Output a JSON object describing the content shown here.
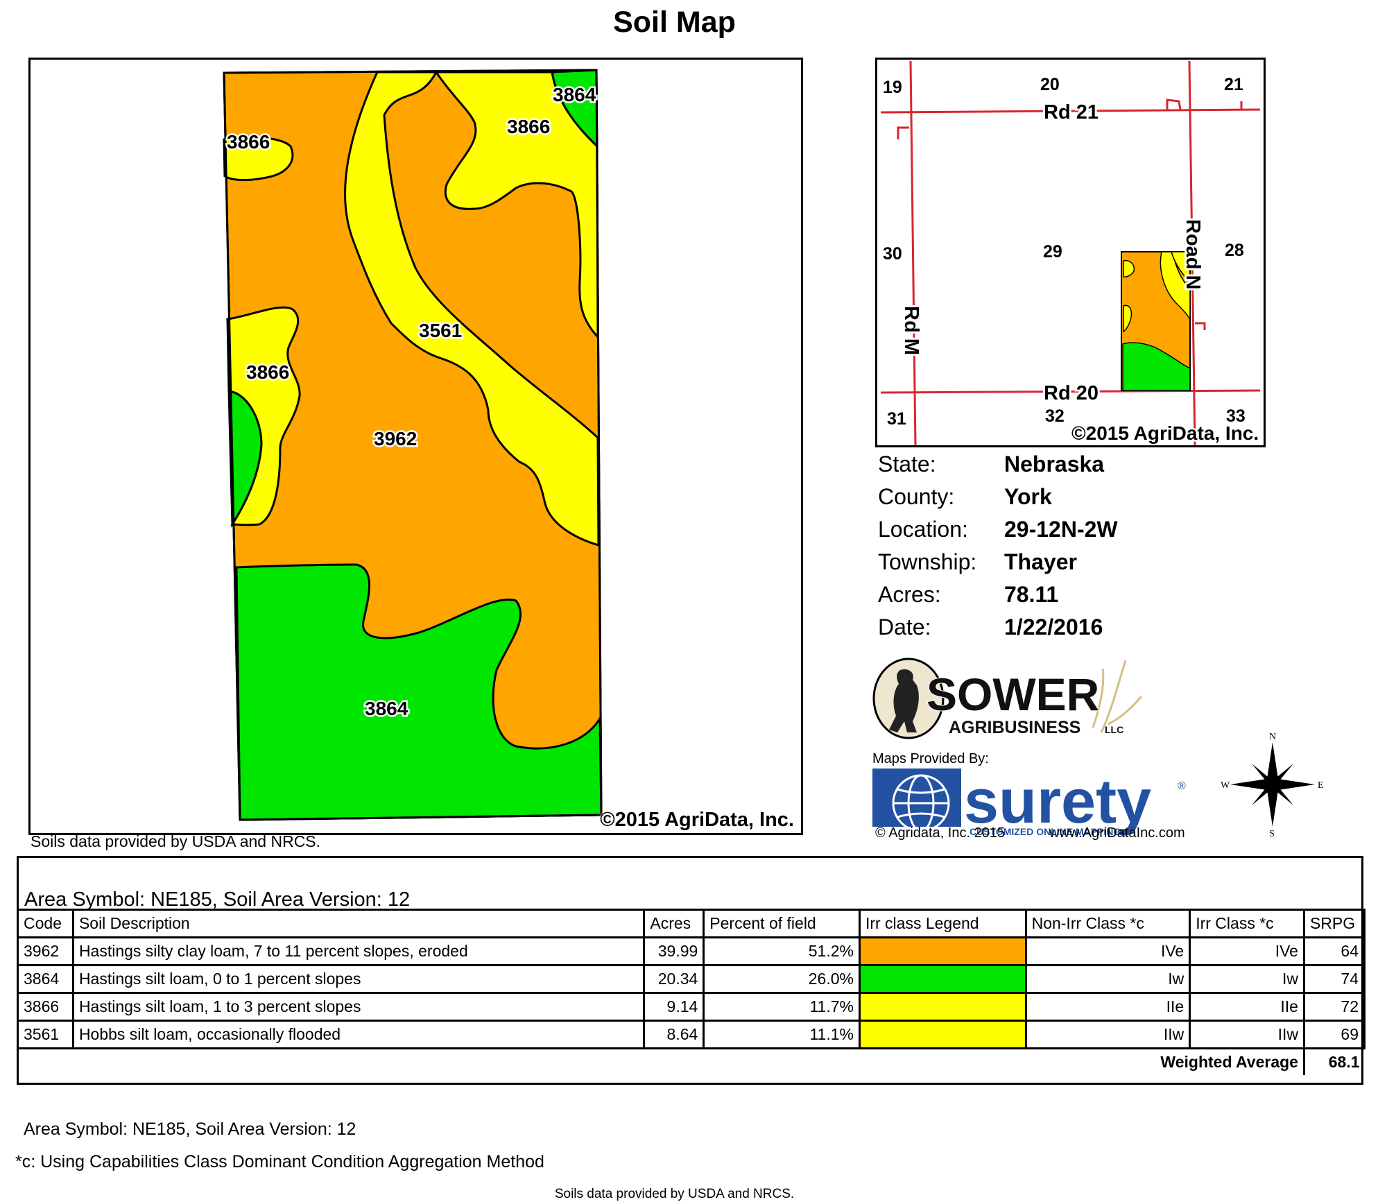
{
  "title": "Soil Map",
  "soil_map": {
    "polygons": [
      {
        "symbol": "3866",
        "color": "#ffff00"
      },
      {
        "symbol": "3864",
        "color": "#00e600"
      },
      {
        "symbol": "3866",
        "color": "#ffff00"
      },
      {
        "symbol": "3561",
        "color": "#ffff00"
      },
      {
        "symbol": "3866",
        "color": "#ffff00"
      },
      {
        "symbol": "3962",
        "color": "#ffa500"
      },
      {
        "symbol": "3864",
        "color": "#00e600"
      }
    ],
    "copyright": "©2015 AgriData, Inc."
  },
  "soils_note": "Soils data provided by USDA and NRCS.",
  "locator_map": {
    "sections": [
      "19",
      "20",
      "21",
      "30",
      "29",
      "28",
      "31",
      "32",
      "33"
    ],
    "roads": [
      "Rd 21",
      "Road N",
      "Rd M",
      "Rd 20"
    ],
    "road_color": "#d9262c",
    "copyright": "©2015 AgriData, Inc."
  },
  "info": [
    {
      "label": "State:",
      "value": "Nebraska"
    },
    {
      "label": "County:",
      "value": "York"
    },
    {
      "label": "Location:",
      "value": "29-12N-2W"
    },
    {
      "label": "Township:",
      "value": "Thayer"
    },
    {
      "label": "Acres:",
      "value": "78.11"
    },
    {
      "label": "Date:",
      "value": "1/22/2016"
    }
  ],
  "logos": {
    "sower_name": "SOWER",
    "sower_sub": "AGRIBUSINESS",
    "sower_llc": "LLC",
    "maps_provided_by": "Maps Provided By:",
    "surety_name": "surety",
    "surety_reg": "®",
    "surety_tagline": "CUSTOMIZED ONLINE MAPPING",
    "agridata_credit": "© Agridata, Inc. 2015",
    "agridata_url": "www.AgriDataInc.com"
  },
  "compass": {
    "n": "N",
    "s": "S",
    "e": "E",
    "w": "W"
  },
  "table": {
    "area_symbol": "Area Symbol: NE185, Soil Area Version: 12",
    "headers": [
      "Code",
      "Soil Description",
      "Acres",
      "Percent of field",
      "Irr class Legend",
      "Non-Irr Class *c",
      "Irr Class *c",
      "SRPG"
    ],
    "rows": [
      {
        "code": "3962",
        "description": "Hastings silty clay loam, 7 to 11 percent slopes, eroded",
        "acres": "39.99",
        "percent": "51.2%",
        "legend_color": "#ffa500",
        "non_irr": "IVe",
        "irr": "IVe",
        "srpg": "64"
      },
      {
        "code": "3864",
        "description": "Hastings silt loam, 0 to 1 percent slopes",
        "acres": "20.34",
        "percent": "26.0%",
        "legend_color": "#00e600",
        "non_irr": "Iw",
        "irr": "Iw",
        "srpg": "74"
      },
      {
        "code": "3866",
        "description": "Hastings silt loam, 1 to 3 percent slopes",
        "acres": "9.14",
        "percent": "11.7%",
        "legend_color": "#ffff00",
        "non_irr": "IIe",
        "irr": "IIe",
        "srpg": "72"
      },
      {
        "code": "3561",
        "description": "Hobbs silt loam, occasionally flooded",
        "acres": "8.64",
        "percent": "11.1%",
        "legend_color": "#ffff00",
        "non_irr": "IIw",
        "irr": "IIw",
        "srpg": "69"
      }
    ],
    "weighted_label": "Weighted Average",
    "weighted_value": "68.1"
  },
  "footer": {
    "area_symbol": "Area Symbol: NE185, Soil Area Version: 12",
    "capability_note": "*c:  Using Capabilities Class Dominant Condition Aggregation Method",
    "soils_note": "Soils data provided by USDA and NRCS."
  }
}
